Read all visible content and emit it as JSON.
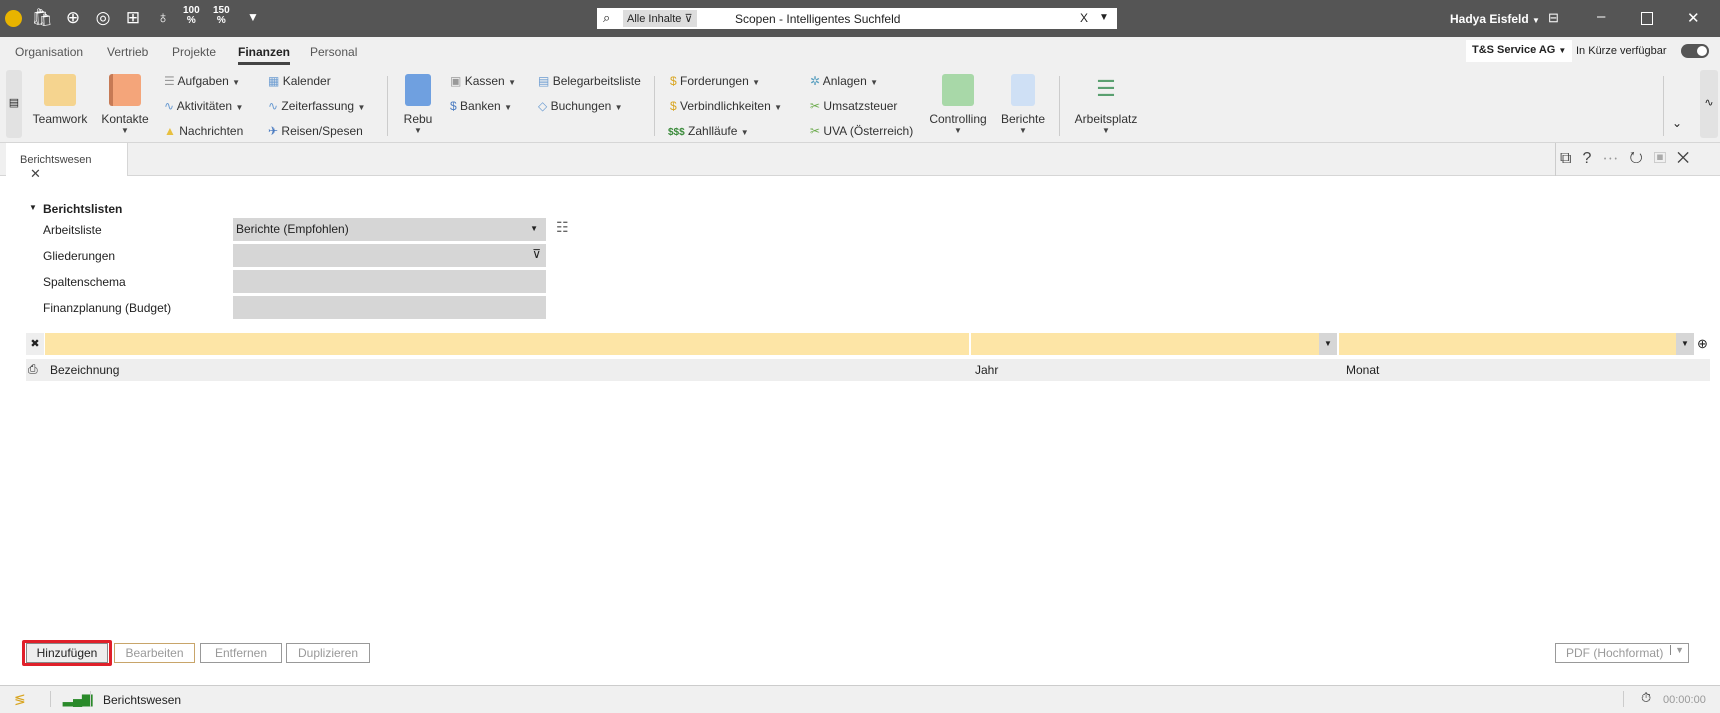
{
  "titlebar": {
    "quick_icons": [
      "app-logo-icon",
      "shopping-bag-icon",
      "plus-circle-icon",
      "lifebuoy-icon",
      "calendar-plus-icon",
      "lightbulb-icon"
    ],
    "zoom100": "100",
    "zoom150": "150",
    "pct": "%",
    "search": {
      "scope": "Alle Inhalte",
      "placeholder": "Scopen - Intelligentes Suchfeld",
      "clear": "X"
    },
    "user": "Hadya Eisfeld"
  },
  "menu_tabs": [
    "Organisation",
    "Vertrieb",
    "Projekte",
    "Finanzen",
    "Personal"
  ],
  "active_tab": "Finanzen",
  "company": "T&S Service AG",
  "coming_soon": "In Kürze verfügbar",
  "ribbon": {
    "teamwork": "Teamwork",
    "kontakte": "Kontakte",
    "aufgaben": "Aufgaben",
    "aktivitaeten": "Aktivitäten",
    "nachrichten": "Nachrichten",
    "kalender": "Kalender",
    "zeiterfassung": "Zeiterfassung",
    "reisen": "Reisen/Spesen",
    "rebu": "Rebu",
    "kassen": "Kassen",
    "banken": "Banken",
    "belegarbeitsliste": "Belegarbeitsliste",
    "buchungen": "Buchungen",
    "forderungen": "Forderungen",
    "verbindlichkeiten": "Verbindlichkeiten",
    "zahllaeufe": "Zahlläufe",
    "anlagen": "Anlagen",
    "umsatzsteuer": "Umsatzsteuer",
    "uva": "UVA (Österreich)",
    "controlling": "Controlling",
    "berichte": "Berichte",
    "arbeitsplatz": "Arbeitsplatz"
  },
  "doc_tab": {
    "label": "Berichtswesen",
    "close": "✕"
  },
  "section": {
    "title": "Berichtslisten",
    "fields": [
      {
        "label": "Arbeitsliste",
        "value": "Berichte (Empfohlen)"
      },
      {
        "label": "Gliederungen",
        "value": ""
      },
      {
        "label": "Spaltenschema",
        "value": ""
      },
      {
        "label": "Finanzplanung (Budget)",
        "value": ""
      }
    ]
  },
  "grid": {
    "columns": [
      "Bezeichnung",
      "Jahr",
      "Monat"
    ],
    "rows": []
  },
  "buttons": {
    "add": "Hinzufügen",
    "edit": "Bearbeiten",
    "remove": "Entfernen",
    "duplicate": "Duplizieren",
    "export": "PDF (Hochformat)"
  },
  "status": {
    "module": "Berichtswesen",
    "timer": "00:00:00"
  },
  "colors": {
    "titlebar": "#555555",
    "filter_row": "#fde5a6",
    "highlight": "#e0202a"
  }
}
